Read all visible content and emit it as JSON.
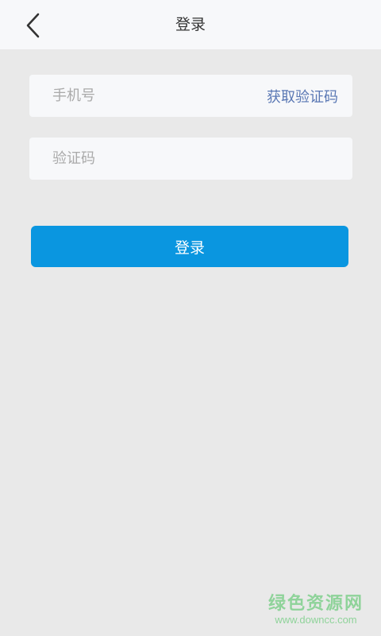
{
  "header": {
    "title": "登录",
    "back_icon": "chevron-left-icon"
  },
  "form": {
    "phone": {
      "placeholder": "手机号",
      "value": ""
    },
    "get_code_label": "获取验证码",
    "code": {
      "placeholder": "验证码",
      "value": ""
    },
    "login_label": "登录"
  },
  "watermark": {
    "name": "绿色资源网",
    "url": "www.downcc.com"
  },
  "colors": {
    "page_background": "#e9e9e9",
    "bar_background": "#f7f8fa",
    "primary_button": "#0a96e0",
    "link": "#5a78b4",
    "watermark": "#8fd39a"
  }
}
